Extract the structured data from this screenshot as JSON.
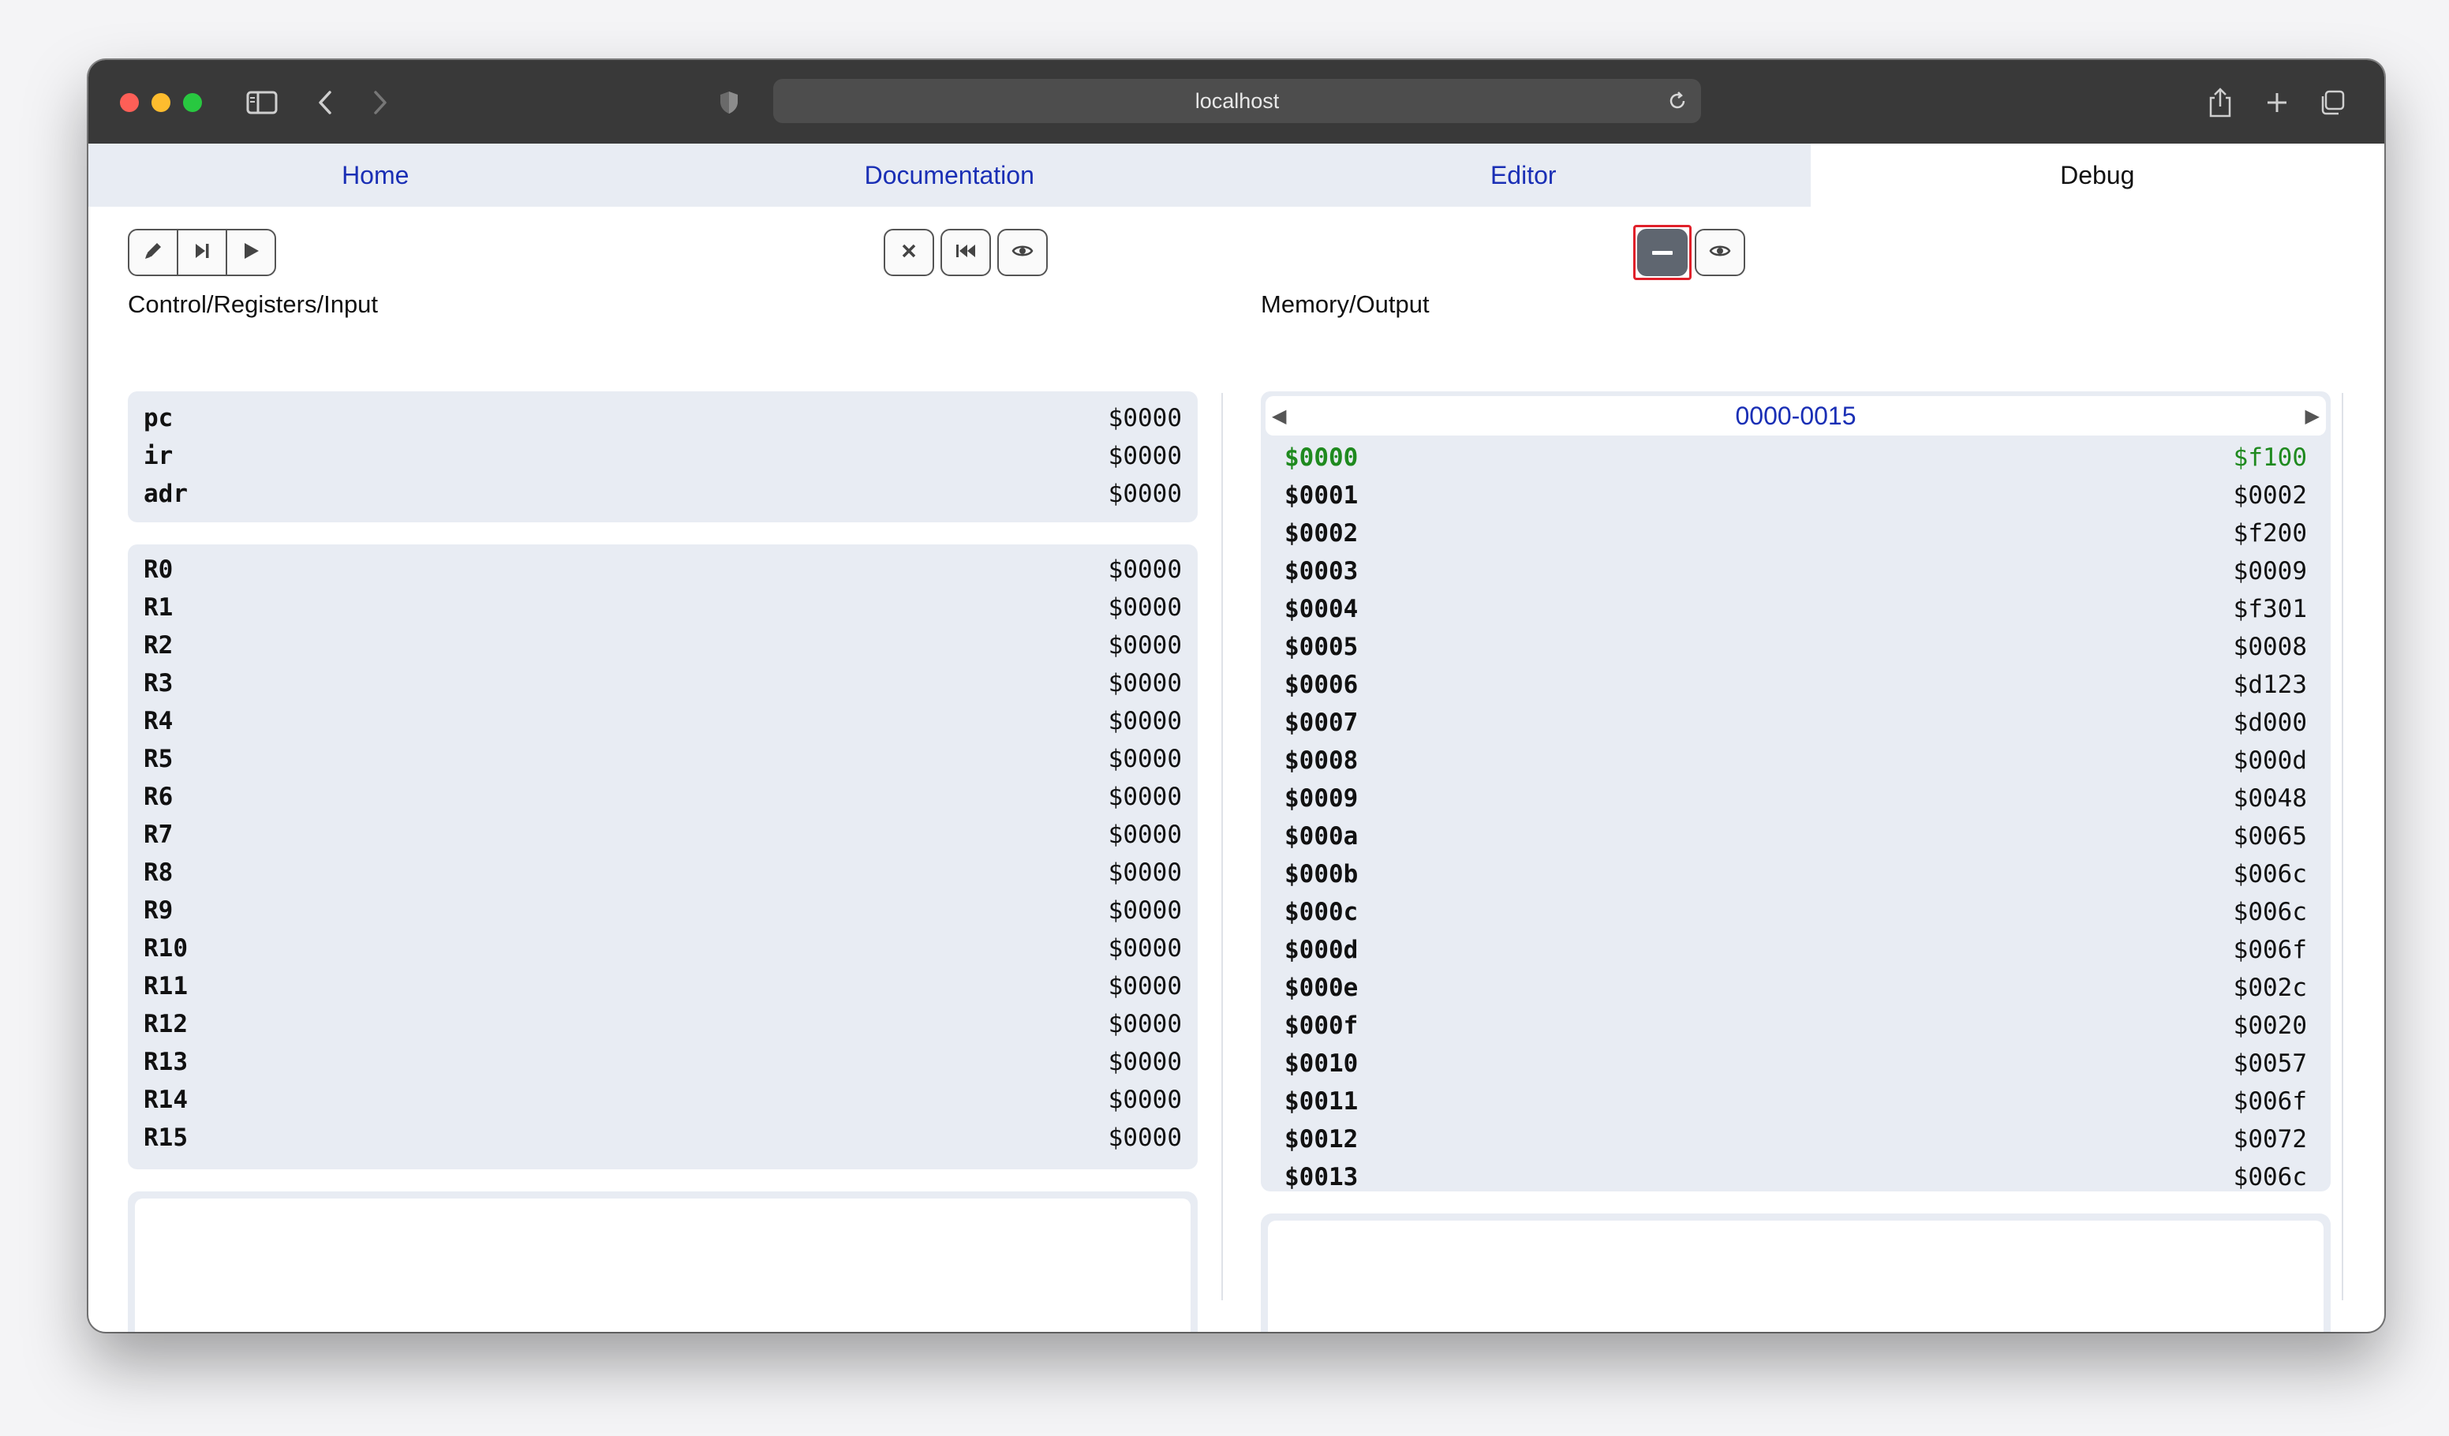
{
  "browser": {
    "url": "localhost"
  },
  "nav": {
    "tabs": [
      {
        "label": "Home",
        "active": false
      },
      {
        "label": "Documentation",
        "active": false
      },
      {
        "label": "Editor",
        "active": false
      },
      {
        "label": "Debug",
        "active": true
      }
    ]
  },
  "left": {
    "title": "Control/Registers/Input",
    "toolbar": [
      "pencil-icon",
      "step-icon",
      "play-icon"
    ],
    "control": [
      {
        "name": "pc",
        "value": "$0000"
      },
      {
        "name": "ir",
        "value": "$0000"
      },
      {
        "name": "adr",
        "value": "$0000"
      }
    ],
    "registers": [
      {
        "name": "R0",
        "value": "$0000"
      },
      {
        "name": "R1",
        "value": "$0000"
      },
      {
        "name": "R2",
        "value": "$0000"
      },
      {
        "name": "R3",
        "value": "$0000"
      },
      {
        "name": "R4",
        "value": "$0000"
      },
      {
        "name": "R5",
        "value": "$0000"
      },
      {
        "name": "R6",
        "value": "$0000"
      },
      {
        "name": "R7",
        "value": "$0000"
      },
      {
        "name": "R8",
        "value": "$0000"
      },
      {
        "name": "R9",
        "value": "$0000"
      },
      {
        "name": "R10",
        "value": "$0000"
      },
      {
        "name": "R11",
        "value": "$0000"
      },
      {
        "name": "R12",
        "value": "$0000"
      },
      {
        "name": "R13",
        "value": "$0000"
      },
      {
        "name": "R14",
        "value": "$0000"
      },
      {
        "name": "R15",
        "value": "$0000"
      }
    ],
    "input_value": ""
  },
  "center_toolbar": [
    "close-icon",
    "rewind-icon",
    "eye-icon"
  ],
  "right": {
    "title": "Memory/Output",
    "toolbar": [
      "minus-icon",
      "eye-icon"
    ],
    "range_label": "0000-0015",
    "memory": [
      {
        "addr": "$0000",
        "value": "$f100",
        "current": true
      },
      {
        "addr": "$0001",
        "value": "$0002"
      },
      {
        "addr": "$0002",
        "value": "$f200"
      },
      {
        "addr": "$0003",
        "value": "$0009"
      },
      {
        "addr": "$0004",
        "value": "$f301"
      },
      {
        "addr": "$0005",
        "value": "$0008"
      },
      {
        "addr": "$0006",
        "value": "$d123"
      },
      {
        "addr": "$0007",
        "value": "$d000"
      },
      {
        "addr": "$0008",
        "value": "$000d"
      },
      {
        "addr": "$0009",
        "value": "$0048"
      },
      {
        "addr": "$000a",
        "value": "$0065"
      },
      {
        "addr": "$000b",
        "value": "$006c"
      },
      {
        "addr": "$000c",
        "value": "$006c"
      },
      {
        "addr": "$000d",
        "value": "$006f"
      },
      {
        "addr": "$000e",
        "value": "$002c"
      },
      {
        "addr": "$000f",
        "value": "$0020"
      },
      {
        "addr": "$0010",
        "value": "$0057"
      },
      {
        "addr": "$0011",
        "value": "$006f"
      },
      {
        "addr": "$0012",
        "value": "$0072"
      },
      {
        "addr": "$0013",
        "value": "$006c"
      }
    ],
    "output_value": ""
  },
  "colors": {
    "accent": "#1a2fb5",
    "panel": "#e8ecf3",
    "current": "#1f8a1f",
    "highlight": "#e0202a"
  }
}
